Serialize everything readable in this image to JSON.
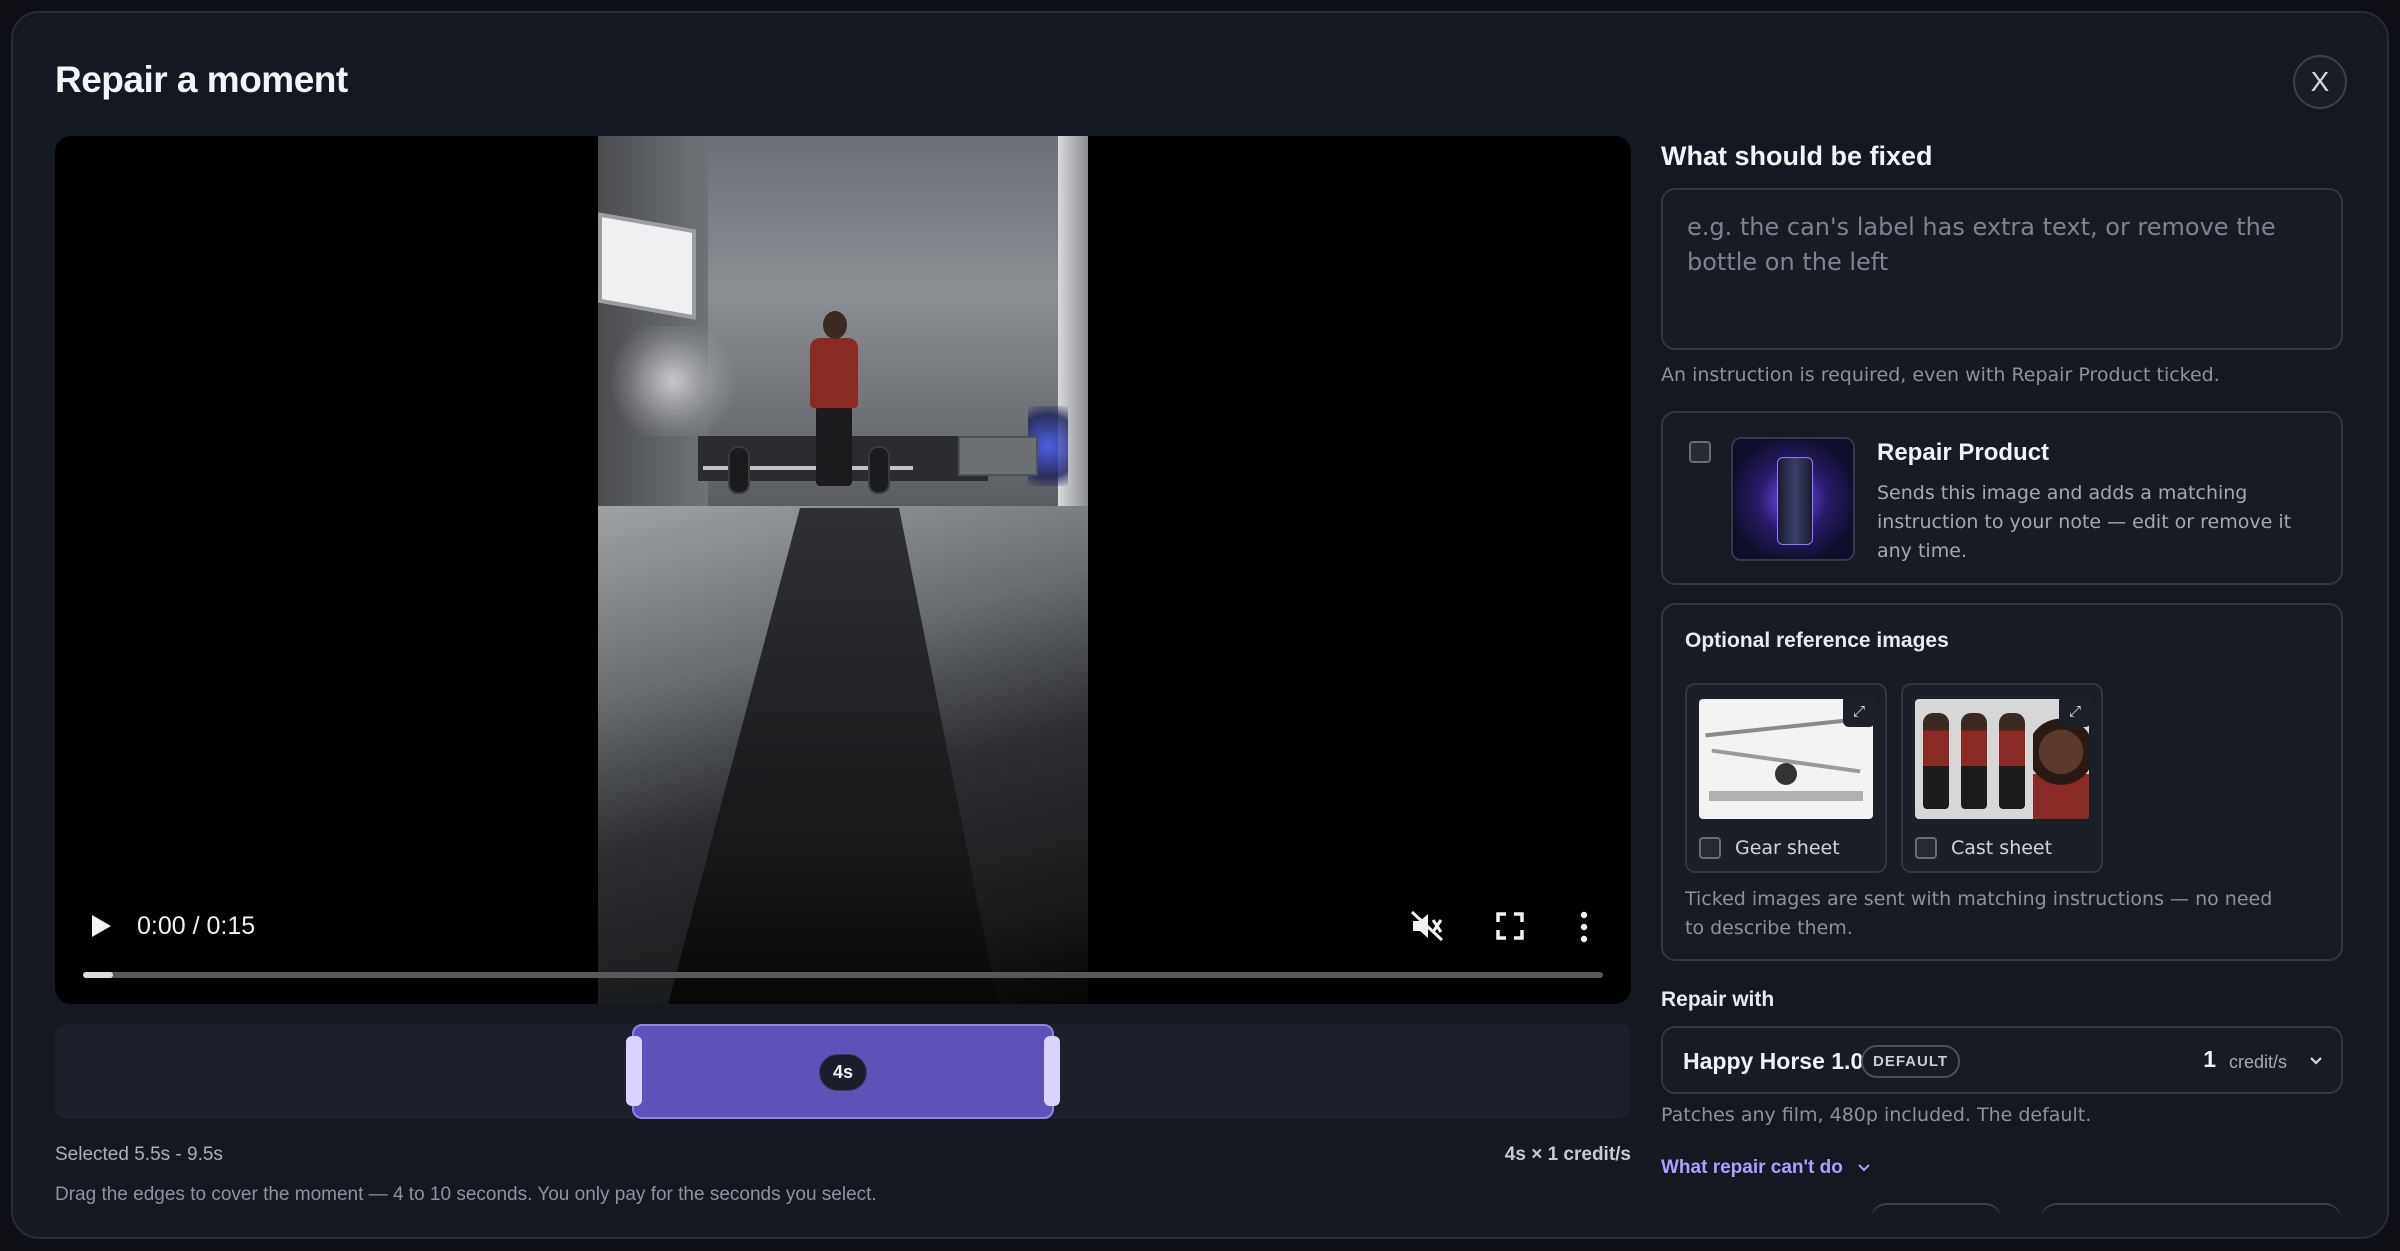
{
  "modal": {
    "title": "Repair a moment",
    "close_label": "X"
  },
  "video": {
    "current_time": "0:00",
    "duration": "0:15",
    "time_display": "0:00 / 0:15",
    "progress": 0.02
  },
  "timeline": {
    "duration_seconds": 15,
    "selection_start": 5.5,
    "selection_end": 9.5,
    "badge": "4s",
    "selected_text": "Selected 5.5s - 9.5s",
    "cost_text": "4s × 1 credit/s",
    "hint": "Drag the edges to cover the moment — 4 to 10 seconds. You only pay for the seconds you select."
  },
  "fix": {
    "heading": "What should be fixed",
    "placeholder": "e.g. the can's label has extra text, or remove the bottle on the left",
    "value": "",
    "required_note": "An instruction is required, even with Repair Product ticked."
  },
  "repair_product": {
    "checked": false,
    "title": "Repair Product",
    "description": "Sends this image and adds a matching instruction to your note — edit or remove it any time."
  },
  "references": {
    "title": "Optional reference images",
    "items": [
      {
        "label": "Gear sheet",
        "checked": false
      },
      {
        "label": "Cast sheet",
        "checked": false
      }
    ],
    "expand_label": "⤢",
    "note": "Ticked images are sent with matching instructions — no need to describe them."
  },
  "repair_with": {
    "heading": "Repair with",
    "model_name": "Happy Horse 1.0",
    "badge": "DEFAULT",
    "credits": "1",
    "credits_unit": "credit/s",
    "description": "Patches any film, 480p included. The default.",
    "cant_do_label": "What repair can't do"
  },
  "colors": {
    "accent": "#5e52b8",
    "accent_light": "#a9a2ff",
    "panel": "#141821"
  }
}
